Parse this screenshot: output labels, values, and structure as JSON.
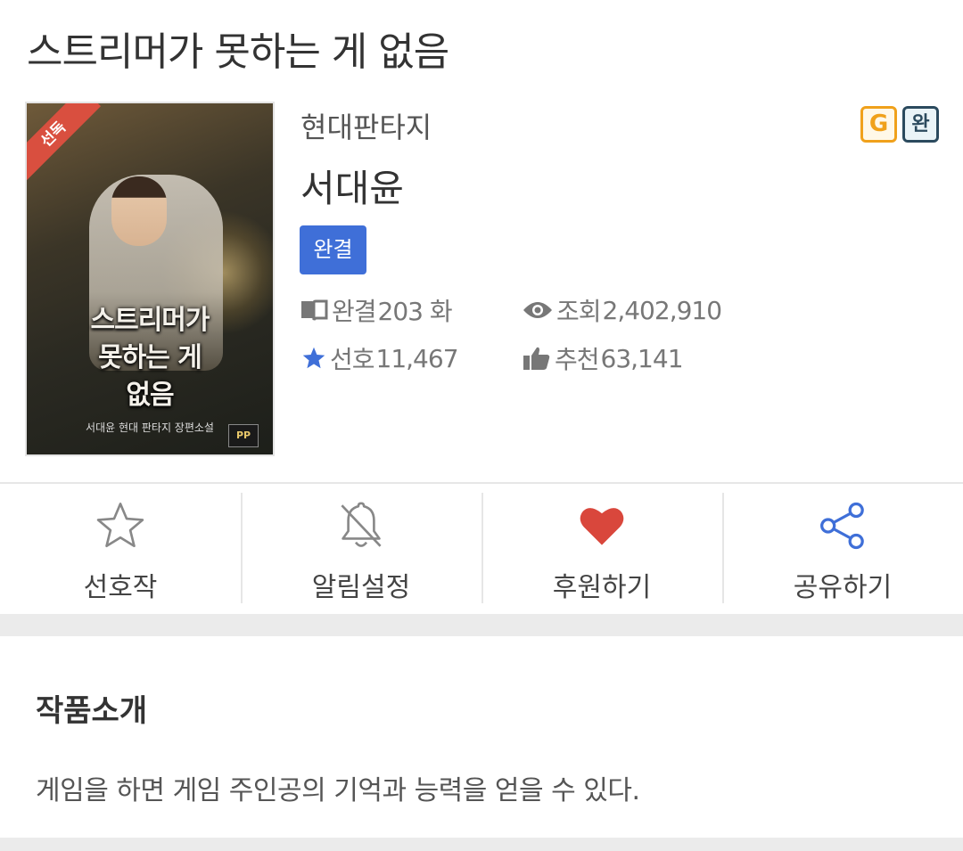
{
  "work": {
    "title": "스트리머가 못하는 게 없음",
    "genre": "현대판타지",
    "author": "서대윤",
    "status_tag": "완결"
  },
  "cover": {
    "ribbon": "선독",
    "title_line1": "스트리머가",
    "title_line2": "못하는 게",
    "title_line3": "없음",
    "subtitle": "서대윤 현대 판타지 장편소설",
    "publisher_logo": "PP"
  },
  "badges": {
    "g": "G",
    "complete": "완"
  },
  "stats": {
    "episodes_label": "완결",
    "episodes_value": "203 화",
    "views_label": "조회",
    "views_value": "2,402,910",
    "favorites_label": "선호",
    "favorites_value": "11,467",
    "recommend_label": "추천",
    "recommend_value": "63,141"
  },
  "actions": {
    "favorite": "선호작",
    "notify": "알림설정",
    "support": "후원하기",
    "share": "공유하기"
  },
  "intro": {
    "heading": "작품소개",
    "text": "게임을 하면 게임 주인공의 기억과 능력을 얻을 수 있다."
  },
  "colors": {
    "accent_blue": "#3f6fd8",
    "heart_red": "#d9473c",
    "badge_g": "#f0a11b",
    "badge_complete": "#2b4a5e",
    "ribbon_red": "#d94f3f"
  },
  "icons": {
    "episodes": "book-icon",
    "views": "eye-icon",
    "favorites": "star-filled-icon",
    "recommend": "thumbs-up-icon",
    "favorite_action": "star-outline-icon",
    "notify_action": "bell-off-icon",
    "support_action": "heart-icon",
    "share_action": "share-icon"
  }
}
